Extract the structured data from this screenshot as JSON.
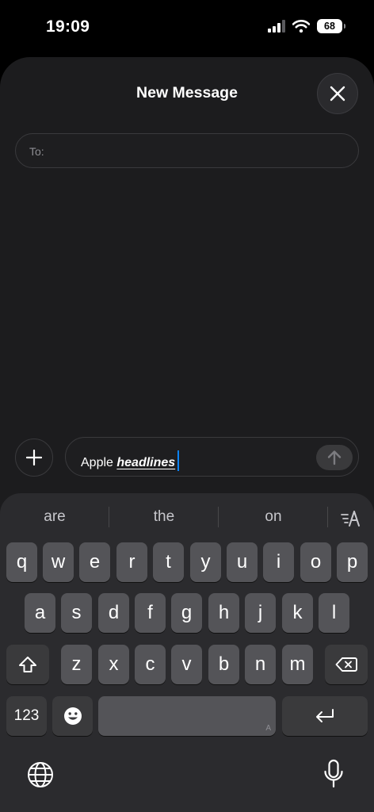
{
  "status_bar": {
    "time": "19:09",
    "battery": "68"
  },
  "compose": {
    "title": "New Message",
    "to_label": "To:",
    "message_text_plain": "Apple ",
    "message_text_highlight": "headlines"
  },
  "suggestions": [
    "are",
    "the",
    "on"
  ],
  "keyboard": {
    "row1": [
      "q",
      "w",
      "e",
      "r",
      "t",
      "y",
      "u",
      "i",
      "o",
      "p"
    ],
    "row2": [
      "a",
      "s",
      "d",
      "f",
      "g",
      "h",
      "j",
      "k",
      "l"
    ],
    "row3": [
      "z",
      "x",
      "c",
      "v",
      "b",
      "n",
      "m"
    ],
    "numbers_label": "123",
    "space_hint": "A"
  },
  "icons": {
    "close": "close-icon",
    "add": "plus-icon",
    "send": "arrow-up-icon",
    "format": "text-format-icon",
    "shift": "shift-icon",
    "delete": "delete-backward-icon",
    "emoji": "emoji-icon",
    "return": "return-icon",
    "globe": "globe-icon",
    "mic": "microphone-icon"
  },
  "colors": {
    "cursor": "#0a84ff",
    "sheet": "#1c1c1e",
    "key": "#545458",
    "key_fn": "#3a3a3c"
  }
}
